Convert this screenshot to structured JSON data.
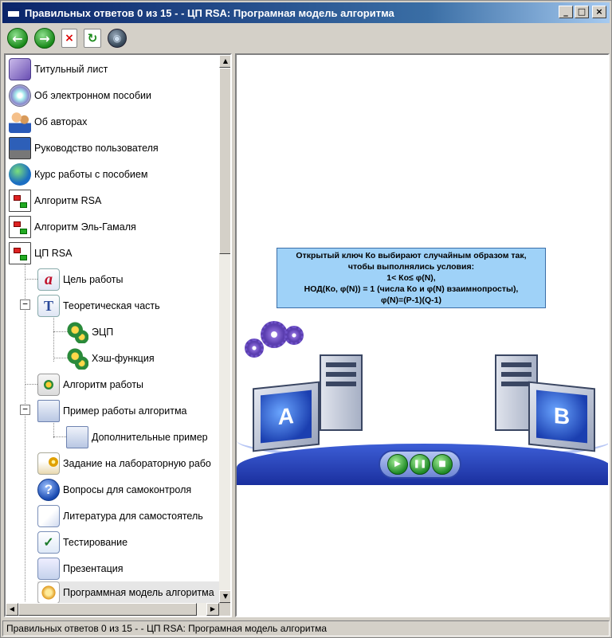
{
  "window": {
    "title": "Правильных ответов 0 из 15 -  - ЦП RSA: Програмная модель алгоритма",
    "minimize_label": "_",
    "maximize_label": "□",
    "close_label": "×"
  },
  "toolbar": {
    "back_icon": "←",
    "forward_icon": "→",
    "stop_icon": "×",
    "refresh_icon": "↻",
    "globe_icon": "◉"
  },
  "tree": {
    "items": [
      {
        "label": "Титульный лист",
        "icon": "title-page-icon"
      },
      {
        "label": "Об электронном пособии",
        "icon": "disc-icon"
      },
      {
        "label": "Об авторах",
        "icon": "people-icon"
      },
      {
        "label": "Руководство пользователя",
        "icon": "computer-icon"
      },
      {
        "label": "Курс работы с пособием",
        "icon": "globe-icon"
      },
      {
        "label": "Алгоритм RSA",
        "icon": "document-icon"
      },
      {
        "label": "Алгоритм Эль-Гамаля",
        "icon": "document-icon"
      },
      {
        "label": "ЦП RSA",
        "icon": "document-icon"
      },
      {
        "label": "Цель работы",
        "icon": "letter-a-icon",
        "glyph": "a"
      },
      {
        "label": "Теоретическая часть",
        "icon": "letter-t-icon",
        "glyph": "T"
      },
      {
        "label": "ЭЦП",
        "icon": "gears-icon"
      },
      {
        "label": "Хэш-функция",
        "icon": "gears-icon"
      },
      {
        "label": "Алгоритм работы",
        "icon": "algorithm-icon"
      },
      {
        "label": "Пример работы алгоритма",
        "icon": "calculator-icon"
      },
      {
        "label": "Дополнительные пример",
        "icon": "calculator-icon"
      },
      {
        "label": "Задание на лабораторную рабо",
        "icon": "task-icon"
      },
      {
        "label": "Вопросы для самоконтроля",
        "icon": "question-icon",
        "glyph": "?"
      },
      {
        "label": "Литература для самостоятель",
        "icon": "literature-icon"
      },
      {
        "label": "Тестирование",
        "icon": "test-icon",
        "glyph": "✓"
      },
      {
        "label": "Презентация",
        "icon": "presentation-icon"
      },
      {
        "label": "Программная модель алгоритма",
        "icon": "model-icon"
      }
    ],
    "expander_minus": "−"
  },
  "scroll": {
    "up": "▲",
    "down": "▼",
    "left": "◀",
    "right": "▶"
  },
  "content": {
    "info_lines": [
      "Открытый ключ Ко выбирают случайным образом так,",
      "чтобы выполнялись условия:",
      "1< Ко≤ φ(N),",
      "НОД(Ко, φ(N)) = 1 (числа Ко и φ(N) взаимнопросты),",
      "φ(N)=(P-1)(Q-1)"
    ],
    "computer_a_label": "A",
    "computer_b_label": "B",
    "play_icon": "▶",
    "pause_icon": "❚❚",
    "stop_icon": "■"
  },
  "status": {
    "text": "Правильных ответов 0 из 15 -  - ЦП RSA: Програмная модель алгоритма"
  }
}
